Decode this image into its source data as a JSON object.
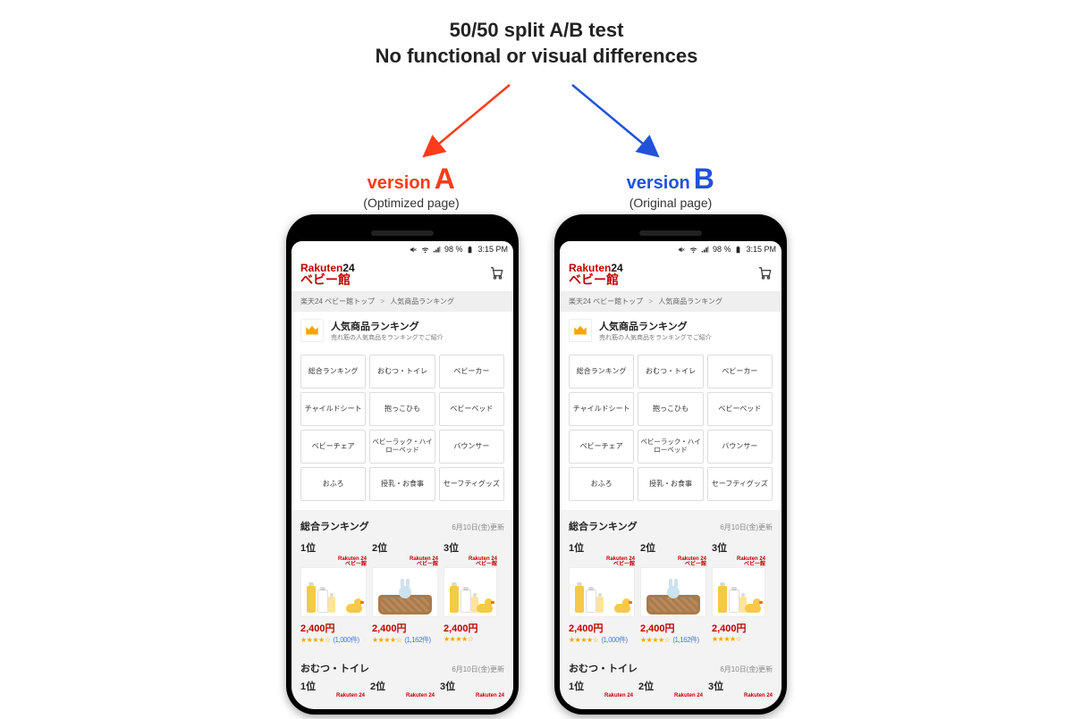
{
  "heading": {
    "line1": "50/50 split A/B test",
    "line2": "No functional or visual differences"
  },
  "versions": {
    "a": {
      "word": "version",
      "letter": "A",
      "subtitle": "(Optimized page)"
    },
    "b": {
      "word": "version",
      "letter": "B",
      "subtitle": "(Original page)"
    }
  },
  "colors": {
    "versionA": "#ff3b1a",
    "versionB": "#2152d9",
    "rakutenRed": "#bf0000",
    "starGold": "#f6a500"
  },
  "status": {
    "battery": "98 %",
    "time": "3:15 PM"
  },
  "header": {
    "brandLine1a": "Rakuten",
    "brandLine1b": "24",
    "brandLine2": "ベビー館"
  },
  "breadcrumb": {
    "part1": "楽天24 ベビー館トップ",
    "sep": ">",
    "part2": "人気商品ランキング"
  },
  "pageTitle": {
    "title": "人気商品ランキング",
    "subtitle": "売れ筋の人気商品をランキングでご紹介"
  },
  "categories": [
    "総合ランキング",
    "おむつ・トイレ",
    "ベビーカー",
    "チャイルドシート",
    "抱っこひも",
    "ベビーベッド",
    "ベビーチェア",
    "ベビーラック・ハイローベッド",
    "バウンサー",
    "おふろ",
    "授乳・お食事",
    "セーフティグッズ"
  ],
  "section1": {
    "name": "総合ランキング",
    "updated": "6月10日(金)更新",
    "products": [
      {
        "rank": "1位",
        "brand1": "Rakuten 24",
        "brand2": "ベビー館",
        "price": "2,400円",
        "stars": "★★★★☆",
        "reviews": "(1,000件)",
        "art": "bottles"
      },
      {
        "rank": "2位",
        "brand1": "Rakuten 24",
        "brand2": "ベビー館",
        "price": "2,400円",
        "stars": "★★★★☆",
        "reviews": "(1,162件)",
        "art": "basket"
      },
      {
        "rank": "3位",
        "brand1": "Rakuten 24",
        "brand2": "ベビー館",
        "price": "2,400円",
        "stars": "★★★★☆",
        "reviews": "",
        "art": "bottles-cut"
      }
    ]
  },
  "section2": {
    "name": "おむつ・トイレ",
    "updated": "6月10日(金)更新",
    "ranks": [
      {
        "rank": "1位",
        "brand": "Rakuten 24"
      },
      {
        "rank": "2位",
        "brand": "Rakuten 24"
      },
      {
        "rank": "3位",
        "brand": "Rakuten 24"
      }
    ]
  }
}
